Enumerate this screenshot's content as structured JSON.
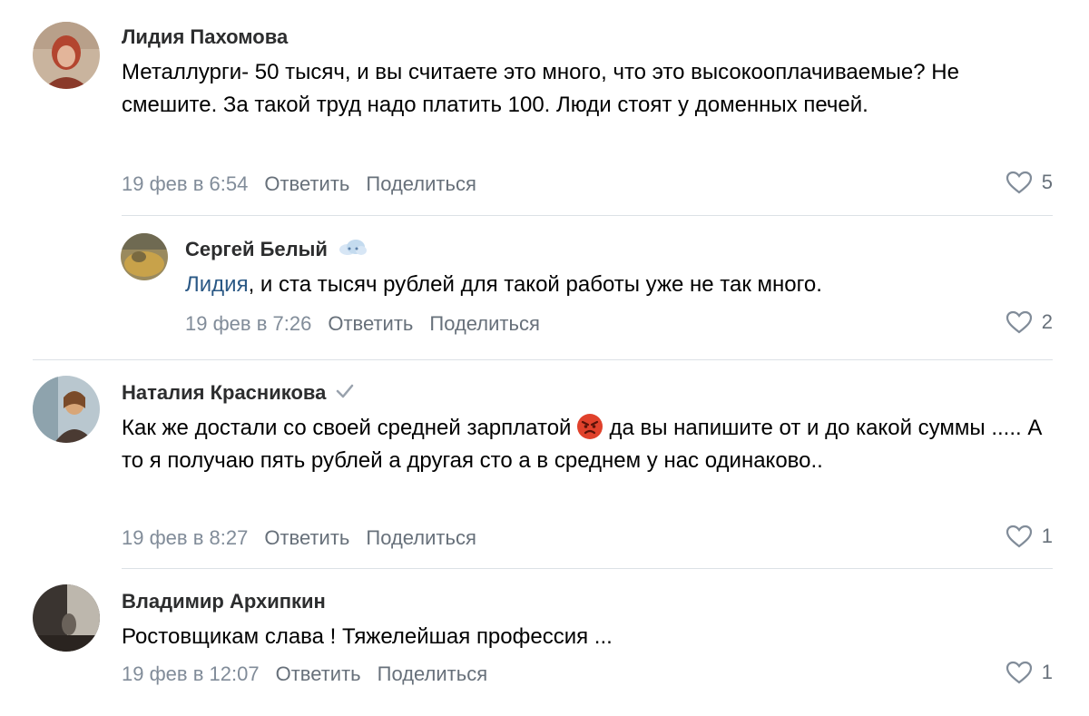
{
  "comments": [
    {
      "author": "Лидия Пахомова",
      "text": "Металлурги- 50 тысяч, и вы считаете это много, что это высокооплачиваемые? Не смешите. За такой труд надо платить 100. Люди стоят у доменных печей.",
      "date": "19 фев в 6:54",
      "reply_label": "Ответить",
      "share_label": "Поделиться",
      "likes": "5"
    },
    {
      "author": "Сергей Белый",
      "author_badge_icon": "cloud-icon",
      "mention": "Лидия",
      "text": ", и ста тысяч рублей для такой работы уже не так много.",
      "date": "19 фев в 7:26",
      "reply_label": "Ответить",
      "share_label": "Поделиться",
      "likes": "2"
    },
    {
      "author": "Наталия Красникова",
      "author_badge_icon": "checkmark-icon",
      "text_before_emoji": "Как же достали со своей средней зарплатой",
      "emoji_icon": "angry-face-icon",
      "text_after_emoji": "да вы напишите от и до какой суммы ..... А то я получаю пять рублей а другая сто а в среднем у нас одинаково..",
      "date": "19 фев в 8:27",
      "reply_label": "Ответить",
      "share_label": "Поделиться",
      "likes": "1"
    },
    {
      "author": "Владимир Архипкин",
      "text": "Ростовщикам слава ! Тяжелейшая профессия ...",
      "date": "19 фев в 12:07",
      "reply_label": "Ответить",
      "share_label": "Поделиться",
      "likes": "1"
    }
  ],
  "colors": {
    "link": "#2a5885",
    "meta": "#818c99",
    "divider": "#dce1e6"
  }
}
